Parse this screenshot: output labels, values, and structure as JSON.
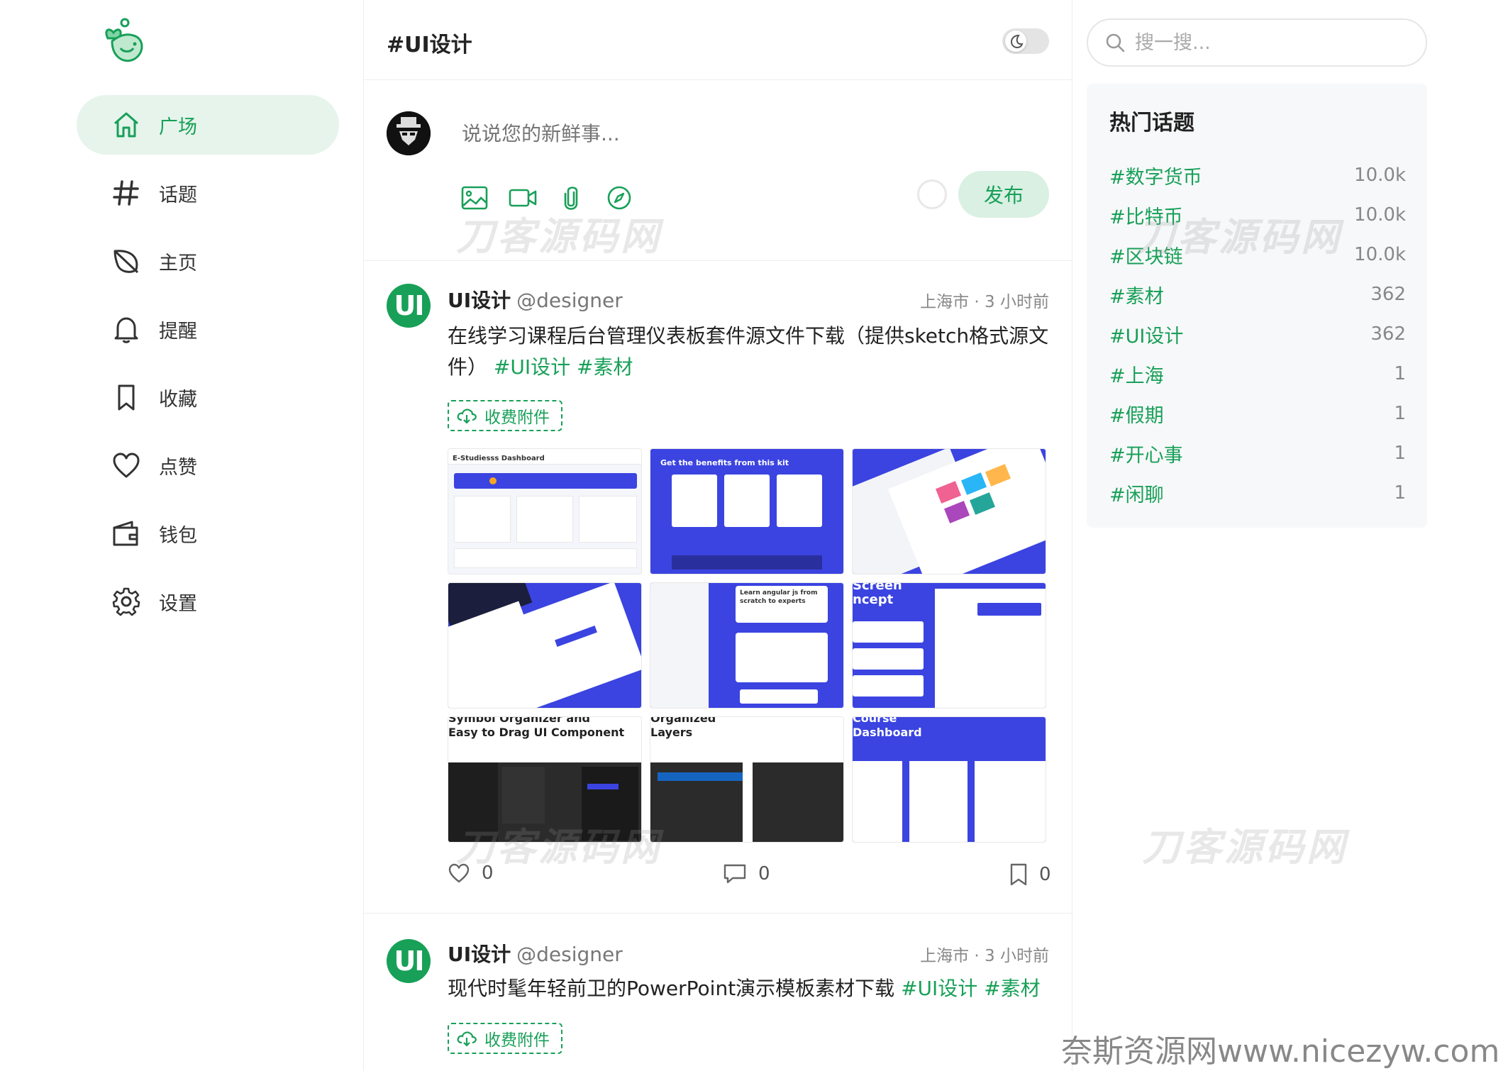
{
  "sidebar": {
    "items": [
      {
        "label": "广场",
        "icon": "home-icon",
        "active": true
      },
      {
        "label": "话题",
        "icon": "hash-icon"
      },
      {
        "label": "主页",
        "icon": "leaf-icon"
      },
      {
        "label": "提醒",
        "icon": "bell-icon"
      },
      {
        "label": "收藏",
        "icon": "bookmark-icon"
      },
      {
        "label": "点赞",
        "icon": "heart-icon"
      },
      {
        "label": "钱包",
        "icon": "wallet-icon"
      },
      {
        "label": "设置",
        "icon": "gear-icon"
      }
    ]
  },
  "header": {
    "title": "#UI设计"
  },
  "composer": {
    "placeholder": "说说您的新鲜事...",
    "publish_label": "发布",
    "tools": [
      "image-icon",
      "video-icon",
      "attachment-icon",
      "compass-icon"
    ]
  },
  "posts": [
    {
      "name": "UI设计",
      "handle": "@designer",
      "meta": "上海市 · 3 小时前",
      "text": "在线学习课程后台管理仪表板套件源文件下载（提供sketch格式源文件）",
      "tags": [
        "#UI设计",
        "#素材"
      ],
      "attachment_label": "收费附件",
      "images": [
        {
          "caption": "E-Studiesss  Dashboard"
        },
        {
          "caption": "Get the benefits from this kit"
        },
        {
          "caption": ""
        },
        {
          "caption": ""
        },
        {
          "caption": "Learn angular js from scratch to experts"
        },
        {
          "caption": "Screen\nncept"
        },
        {
          "caption": "Symbol Organizer and\nEasy to Drag UI Component"
        },
        {
          "caption": "Organized\nLayers"
        },
        {
          "caption": "Course\nDashboard"
        }
      ],
      "likes": "0",
      "comments": "0",
      "collects": "0"
    },
    {
      "name": "UI设计",
      "handle": "@designer",
      "meta": "上海市 · 3 小时前",
      "text": "现代时髦年轻前卫的PowerPoint演示模板素材下载",
      "tags": [
        "#UI设计",
        "#素材"
      ],
      "attachment_label": "收费附件"
    }
  ],
  "search": {
    "placeholder": "搜一搜..."
  },
  "hot_topics": {
    "title": "热门话题",
    "items": [
      {
        "name": "#数字货币",
        "count": "10.0k"
      },
      {
        "name": "#比特币",
        "count": "10.0k"
      },
      {
        "name": "#区块链",
        "count": "10.0k"
      },
      {
        "name": "#素材",
        "count": "362"
      },
      {
        "name": "#UI设计",
        "count": "362"
      },
      {
        "name": "#上海",
        "count": "1"
      },
      {
        "name": "#假期",
        "count": "1"
      },
      {
        "name": "#开心事",
        "count": "1"
      },
      {
        "name": "#闲聊",
        "count": "1"
      }
    ]
  },
  "watermarks": {
    "overlay": "刀客源码网",
    "footer": "奈斯资源网www.nicezyw.com"
  },
  "colors": {
    "accent": "#18a058",
    "accent_soft": "#e6f4ec",
    "border": "#eeeeee"
  }
}
